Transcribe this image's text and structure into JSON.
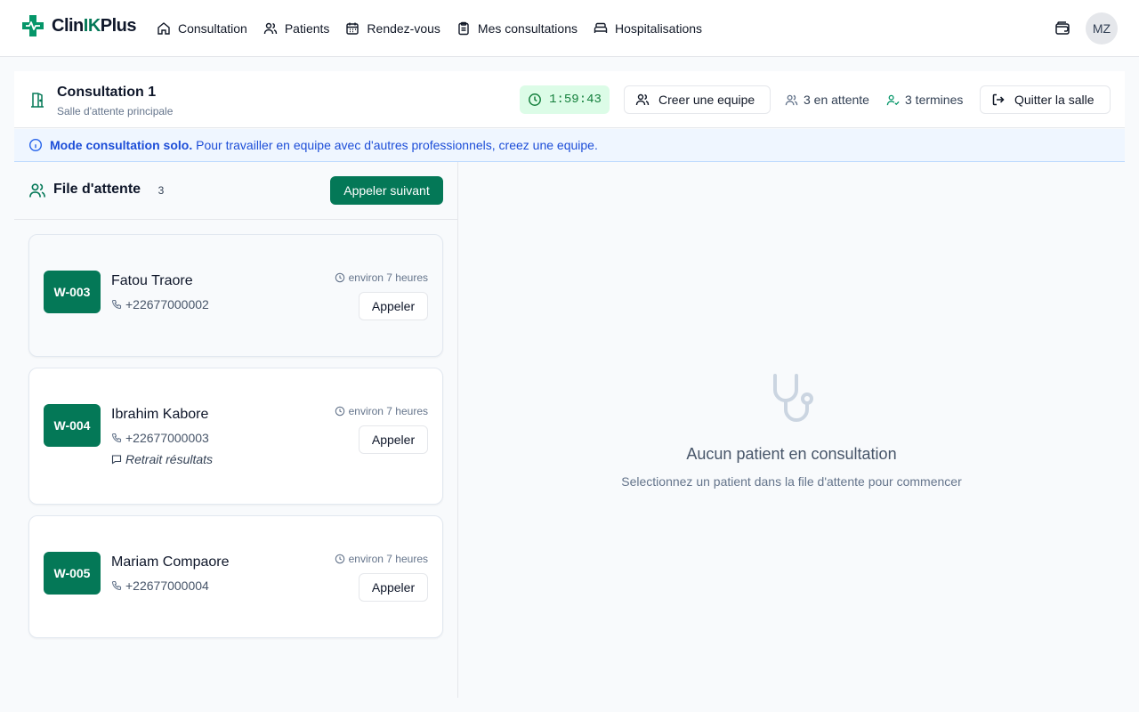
{
  "brand": {
    "name_part1": "Clin",
    "name_part2": "IK",
    "name_part3": "Plus"
  },
  "nav": [
    {
      "label": "Consultation",
      "icon": "home-icon"
    },
    {
      "label": "Patients",
      "icon": "users-icon"
    },
    {
      "label": "Rendez-vous",
      "icon": "calendar-icon"
    },
    {
      "label": "Mes consultations",
      "icon": "clipboard-icon"
    },
    {
      "label": "Hospitalisations",
      "icon": "bed-icon"
    }
  ],
  "user": {
    "initials": "MZ"
  },
  "consultation": {
    "title": "Consultation 1",
    "subtitle": "Salle d'attente principale",
    "timer": "1:59:43",
    "create_team_label": "Creer une equipe",
    "waiting_label": "3 en attente",
    "done_label": "3 termines",
    "quit_label": "Quitter la salle"
  },
  "banner": {
    "bold": "Mode consultation solo.",
    "text": " Pour travailler en equipe avec d'autres professionnels, creez une equipe."
  },
  "queue": {
    "title": "File d'attente",
    "count": "3",
    "call_next_label": "Appeler suivant",
    "items": [
      {
        "code": "W-003",
        "name": "Fatou Traore",
        "phone": "+22677000002",
        "eta": "environ 7 heures",
        "note": "",
        "call_label": "Appeler"
      },
      {
        "code": "W-004",
        "name": "Ibrahim Kabore",
        "phone": "+22677000003",
        "eta": "environ 7 heures",
        "note": "Retrait résultats",
        "call_label": "Appeler"
      },
      {
        "code": "W-005",
        "name": "Mariam Compaore",
        "phone": "+22677000004",
        "eta": "environ 7 heures",
        "note": "",
        "call_label": "Appeler"
      }
    ]
  },
  "empty": {
    "title": "Aucun patient en consultation",
    "subtitle": "Selectionnez un patient dans la file d'attente pour commencer"
  },
  "colors": {
    "accent": "#047857",
    "timer_bg": "#dcfce7",
    "banner_bg": "#eff6ff"
  }
}
